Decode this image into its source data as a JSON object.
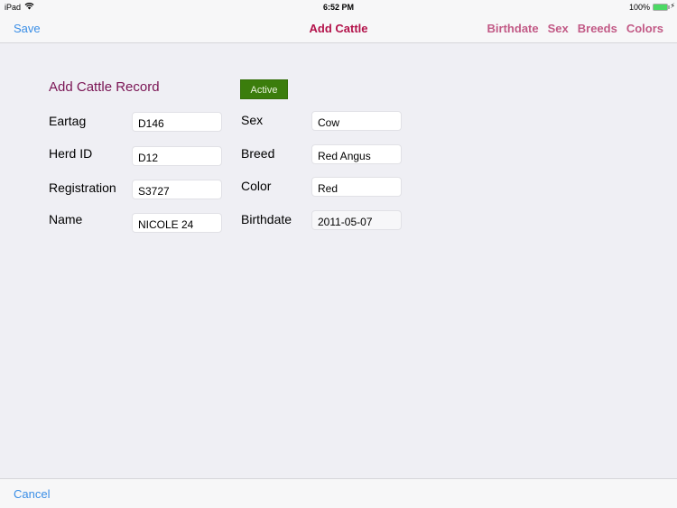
{
  "status_bar": {
    "device": "iPad",
    "time": "6:52 PM",
    "battery": "100%",
    "battery_level": 1.0,
    "icons": [
      "wifi-icon",
      "battery-icon",
      "charging-bolt-icon"
    ]
  },
  "nav": {
    "save_label": "Save",
    "title": "Add Cattle",
    "right_items": [
      "Birthdate",
      "Sex",
      "Breeds",
      "Colors"
    ]
  },
  "form": {
    "title": "Add Cattle Record",
    "active_label": "Active",
    "left_fields": [
      {
        "label": "Eartag",
        "value": "D146"
      },
      {
        "label": "Herd ID",
        "value": "D12"
      },
      {
        "label": "Registration",
        "value": "S3727"
      },
      {
        "label": "Name",
        "value": "NICOLE 24"
      }
    ],
    "right_fields": [
      {
        "label": "Sex",
        "value": "Cow"
      },
      {
        "label": "Breed",
        "value": "Red Angus"
      },
      {
        "label": "Color",
        "value": "Red"
      },
      {
        "label": "Birthdate",
        "value": "2011-05-07"
      }
    ]
  },
  "bottom": {
    "cancel_label": "Cancel"
  },
  "colors": {
    "accent_blue": "#3a8ee6",
    "title_red": "#b3124a",
    "nav_pink": "#c25a86",
    "form_title": "#7a1454",
    "active_green": "#3b7d0c"
  }
}
